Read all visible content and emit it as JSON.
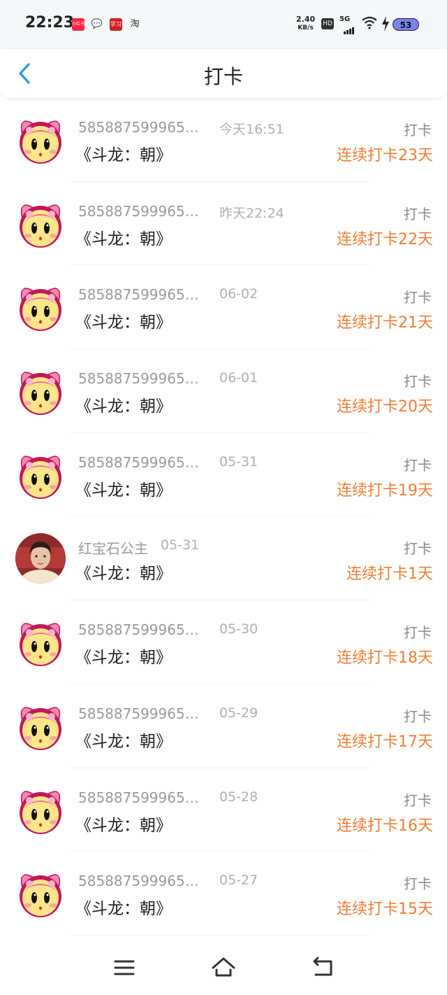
{
  "status_bar": {
    "time": "22:23",
    "apps": [
      "小红书",
      "微信",
      "学习",
      "淘"
    ],
    "net_speed_value": "2.40",
    "net_speed_unit": "KB/s",
    "hd": "HD",
    "network": "5G",
    "battery": "53"
  },
  "header": {
    "title": "打卡"
  },
  "colors": {
    "accent": "#ee7d36",
    "back": "#2d9cdb"
  },
  "items": [
    {
      "name": "5858875999654…",
      "time": "今天16:51",
      "content": "《斗龙：朝》",
      "type": "打卡",
      "streak": "连续打卡23天",
      "avatar": "cartoon-bunny"
    },
    {
      "name": "5858875999654…",
      "time": "昨天22:24",
      "content": "《斗龙：朝》",
      "type": "打卡",
      "streak": "连续打卡22天",
      "avatar": "cartoon-bunny"
    },
    {
      "name": "5858875999654…",
      "time": "06-02",
      "content": "《斗龙：朝》",
      "type": "打卡",
      "streak": "连续打卡21天",
      "avatar": "cartoon-bunny"
    },
    {
      "name": "5858875999654…",
      "time": "06-01",
      "content": "《斗龙：朝》",
      "type": "打卡",
      "streak": "连续打卡20天",
      "avatar": "cartoon-bunny"
    },
    {
      "name": "5858875999654…",
      "time": "05-31",
      "content": "《斗龙：朝》",
      "type": "打卡",
      "streak": "连续打卡19天",
      "avatar": "cartoon-bunny"
    },
    {
      "name": "红宝石公主",
      "time": "05-31",
      "content": "《斗龙：朝》",
      "type": "打卡",
      "streak": "连续打卡1天",
      "avatar": "photo"
    },
    {
      "name": "5858875999654…",
      "time": "05-30",
      "content": "《斗龙：朝》",
      "type": "打卡",
      "streak": "连续打卡18天",
      "avatar": "cartoon-bunny"
    },
    {
      "name": "5858875999654…",
      "time": "05-29",
      "content": "《斗龙：朝》",
      "type": "打卡",
      "streak": "连续打卡17天",
      "avatar": "cartoon-bunny"
    },
    {
      "name": "5858875999654…",
      "time": "05-28",
      "content": "《斗龙：朝》",
      "type": "打卡",
      "streak": "连续打卡16天",
      "avatar": "cartoon-bunny"
    },
    {
      "name": "5858875999654…",
      "time": "05-27",
      "content": "《斗龙：朝》",
      "type": "打卡",
      "streak": "连续打卡15天",
      "avatar": "cartoon-bunny"
    }
  ],
  "nav": {
    "menu": "menu-icon",
    "home": "home-icon",
    "back": "back-icon"
  }
}
